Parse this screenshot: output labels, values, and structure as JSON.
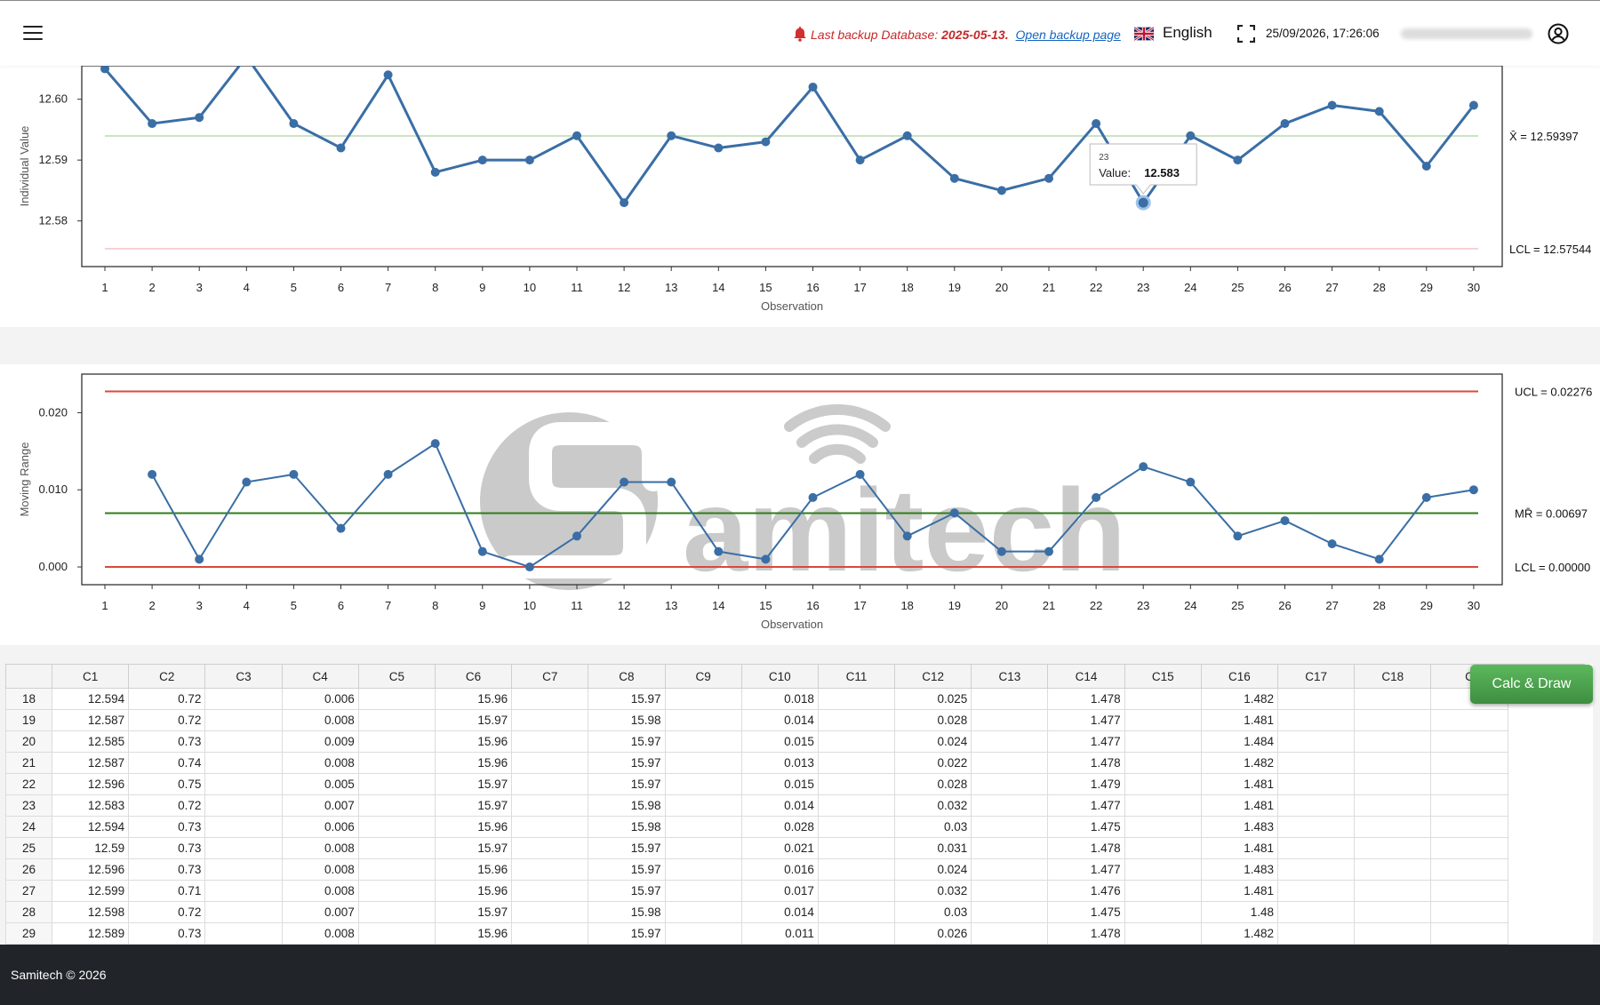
{
  "header": {
    "backup_label": "Last backup Database:",
    "backup_date": "2025-05-13.",
    "backup_link": "Open backup page",
    "language": "English",
    "datetime": "25/09/2026, 17:26:06"
  },
  "chart_data": [
    {
      "type": "line",
      "ylabel": "Individual Value",
      "xlabel": "Observation",
      "x": [
        1,
        2,
        3,
        4,
        5,
        6,
        7,
        8,
        9,
        10,
        11,
        12,
        13,
        14,
        15,
        16,
        17,
        18,
        19,
        20,
        21,
        22,
        23,
        24,
        25,
        26,
        27,
        28,
        29,
        30
      ],
      "values": [
        12.605,
        12.596,
        12.597,
        12.607,
        12.596,
        12.592,
        12.604,
        12.588,
        12.59,
        12.59,
        12.594,
        12.583,
        12.594,
        12.592,
        12.593,
        12.602,
        12.59,
        12.594,
        12.587,
        12.585,
        12.587,
        12.596,
        12.583,
        12.594,
        12.59,
        12.596,
        12.599,
        12.598,
        12.589,
        12.599
      ],
      "yticks": [
        12.58,
        12.59,
        12.6
      ],
      "ylim": [
        12.5725,
        12.6055
      ],
      "center": 12.59397,
      "lcl": 12.57544,
      "center_label": "X̄ = 12.59397",
      "lcl_label": "LCL = 12.57544",
      "tooltip": {
        "index": 23,
        "title": "23",
        "label": "Value:",
        "value": "12.583"
      }
    },
    {
      "type": "line",
      "ylabel": "Moving Range",
      "xlabel": "Observation",
      "x": [
        2,
        3,
        4,
        5,
        6,
        7,
        8,
        9,
        10,
        11,
        12,
        13,
        14,
        15,
        16,
        17,
        18,
        19,
        20,
        21,
        22,
        23,
        24,
        25,
        26,
        27,
        28,
        29,
        30
      ],
      "values": [
        0.012,
        0.001,
        0.011,
        0.012,
        0.005,
        0.012,
        0.016,
        0.002,
        0.0,
        0.004,
        0.011,
        0.011,
        0.002,
        0.001,
        0.009,
        0.012,
        0.004,
        0.007,
        0.002,
        0.002,
        0.009,
        0.013,
        0.011,
        0.004,
        0.006,
        0.003,
        0.001,
        0.009,
        0.01
      ],
      "yticks": [
        0.0,
        0.01,
        0.02
      ],
      "ylim": [
        -0.0023,
        0.025
      ],
      "ucl": 0.02276,
      "center": 0.00697,
      "lcl": 0.0,
      "ucl_label": "UCL = 0.02276",
      "center_label": "MR̄ = 0.00697",
      "lcl_label": "LCL = 0.00000"
    }
  ],
  "watermark": {
    "text": "amitech"
  },
  "table": {
    "columns": [
      "C1",
      "C2",
      "C3",
      "C4",
      "C5",
      "C6",
      "C7",
      "C8",
      "C9",
      "C10",
      "C11",
      "C12",
      "C13",
      "C14",
      "C15",
      "C16",
      "C17",
      "C18",
      "C"
    ],
    "rows": [
      [
        "18",
        "12.594",
        "0.72",
        "",
        "0.006",
        "",
        "15.96",
        "",
        "15.97",
        "",
        "0.018",
        "",
        "0.025",
        "",
        "1.478",
        "",
        "1.482",
        "",
        "",
        ""
      ],
      [
        "19",
        "12.587",
        "0.72",
        "",
        "0.008",
        "",
        "15.97",
        "",
        "15.98",
        "",
        "0.014",
        "",
        "0.028",
        "",
        "1.477",
        "",
        "1.481",
        "",
        "",
        ""
      ],
      [
        "20",
        "12.585",
        "0.73",
        "",
        "0.009",
        "",
        "15.96",
        "",
        "15.97",
        "",
        "0.015",
        "",
        "0.024",
        "",
        "1.477",
        "",
        "1.484",
        "",
        "",
        ""
      ],
      [
        "21",
        "12.587",
        "0.74",
        "",
        "0.008",
        "",
        "15.96",
        "",
        "15.97",
        "",
        "0.013",
        "",
        "0.022",
        "",
        "1.478",
        "",
        "1.482",
        "",
        "",
        ""
      ],
      [
        "22",
        "12.596",
        "0.75",
        "",
        "0.005",
        "",
        "15.97",
        "",
        "15.97",
        "",
        "0.015",
        "",
        "0.028",
        "",
        "1.479",
        "",
        "1.481",
        "",
        "",
        ""
      ],
      [
        "23",
        "12.583",
        "0.72",
        "",
        "0.007",
        "",
        "15.97",
        "",
        "15.98",
        "",
        "0.014",
        "",
        "0.032",
        "",
        "1.477",
        "",
        "1.481",
        "",
        "",
        ""
      ],
      [
        "24",
        "12.594",
        "0.73",
        "",
        "0.006",
        "",
        "15.96",
        "",
        "15.98",
        "",
        "0.028",
        "",
        "0.03",
        "",
        "1.475",
        "",
        "1.483",
        "",
        "",
        ""
      ],
      [
        "25",
        "12.59",
        "0.73",
        "",
        "0.008",
        "",
        "15.97",
        "",
        "15.97",
        "",
        "0.021",
        "",
        "0.031",
        "",
        "1.478",
        "",
        "1.481",
        "",
        "",
        ""
      ],
      [
        "26",
        "12.596",
        "0.73",
        "",
        "0.008",
        "",
        "15.96",
        "",
        "15.97",
        "",
        "0.016",
        "",
        "0.024",
        "",
        "1.477",
        "",
        "1.483",
        "",
        "",
        ""
      ],
      [
        "27",
        "12.599",
        "0.71",
        "",
        "0.008",
        "",
        "15.96",
        "",
        "15.97",
        "",
        "0.017",
        "",
        "0.032",
        "",
        "1.476",
        "",
        "1.481",
        "",
        "",
        ""
      ],
      [
        "28",
        "12.598",
        "0.72",
        "",
        "0.007",
        "",
        "15.97",
        "",
        "15.98",
        "",
        "0.014",
        "",
        "0.03",
        "",
        "1.475",
        "",
        "1.48",
        "",
        "",
        ""
      ],
      [
        "29",
        "12.589",
        "0.73",
        "",
        "0.008",
        "",
        "15.96",
        "",
        "15.97",
        "",
        "0.011",
        "",
        "0.026",
        "",
        "1.478",
        "",
        "1.482",
        "",
        "",
        ""
      ]
    ]
  },
  "calc_button": "Calc & Draw",
  "footer": {
    "text": "Samitech © 2026"
  },
  "colors": {
    "line": "#3a6ea5",
    "limit": "#d9493a",
    "center_mr": "#2e7d1a",
    "center_i": "#b7dcae",
    "lcl_i": "#f4c4c4",
    "calc_button": "#4cae4c",
    "footer_bg": "#212529"
  }
}
